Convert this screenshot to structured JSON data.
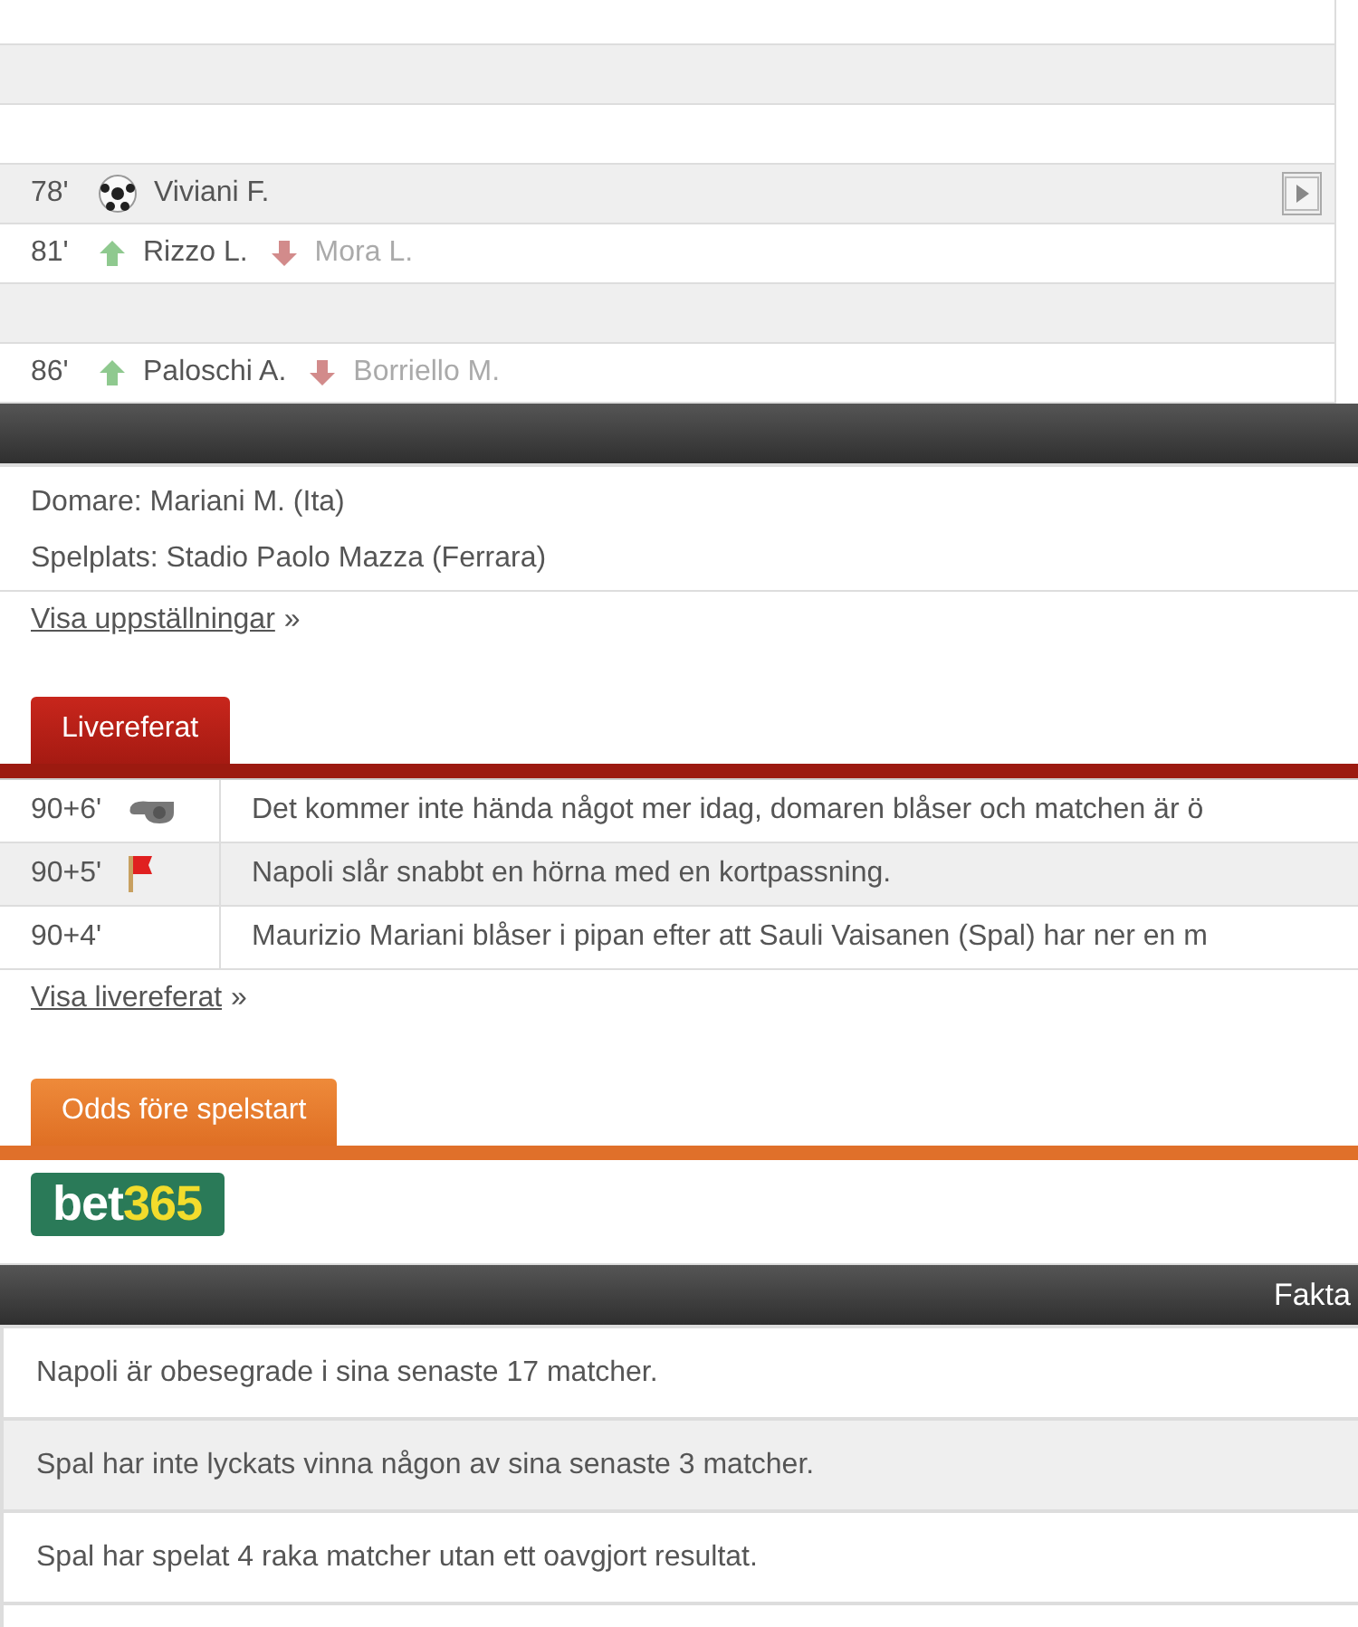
{
  "events": [
    {
      "kind": "empty"
    },
    {
      "kind": "empty"
    },
    {
      "kind": "empty"
    },
    {
      "kind": "goal",
      "minute": "78'",
      "player": "Viviani F.",
      "video": true
    },
    {
      "kind": "substitution",
      "minute": "81'",
      "player_in": "Rizzo L.",
      "player_out": "Mora L.",
      "video": false
    },
    {
      "kind": "empty"
    },
    {
      "kind": "substitution",
      "minute": "86'",
      "player_in": "Paloschi A.",
      "player_out": "Borriello M.",
      "video": false
    }
  ],
  "match_info": {
    "referee": "Domare: Mariani M. (Ita)",
    "venue": "Spelplats: Stadio Paolo Mazza (Ferrara)",
    "lineups_link": "Visa uppställningar",
    "lineups_arrow": "»"
  },
  "live": {
    "tab": "Livereferat",
    "rows": [
      {
        "minute": "90+6'",
        "kind": "whistle",
        "text": "Det kommer inte hända något mer idag, domaren blåser och matchen är ö"
      },
      {
        "minute": "90+5'",
        "kind": "corner",
        "text": "Napoli slår snabbt en hörna med en kortpassning."
      },
      {
        "minute": "90+4'",
        "kind": "none",
        "text": "Maurizio Mariani blåser i pipan efter att Sauli Vaisanen (Spal) har ner en m"
      }
    ],
    "link": "Visa livereferat",
    "arrow": "»"
  },
  "odds": {
    "tab": "Odds före spelstart",
    "bookmaker": "bet",
    "bookmaker_accent": "365"
  },
  "facts": {
    "title": "Fakta",
    "items": [
      "Napoli är obesegrade i sina senaste 17 matcher.",
      "Spal har inte lyckats vinna någon av sina senaste 3 matcher.",
      "Spal har spelat 4 raka matcher utan ett oavgjort resultat."
    ]
  }
}
